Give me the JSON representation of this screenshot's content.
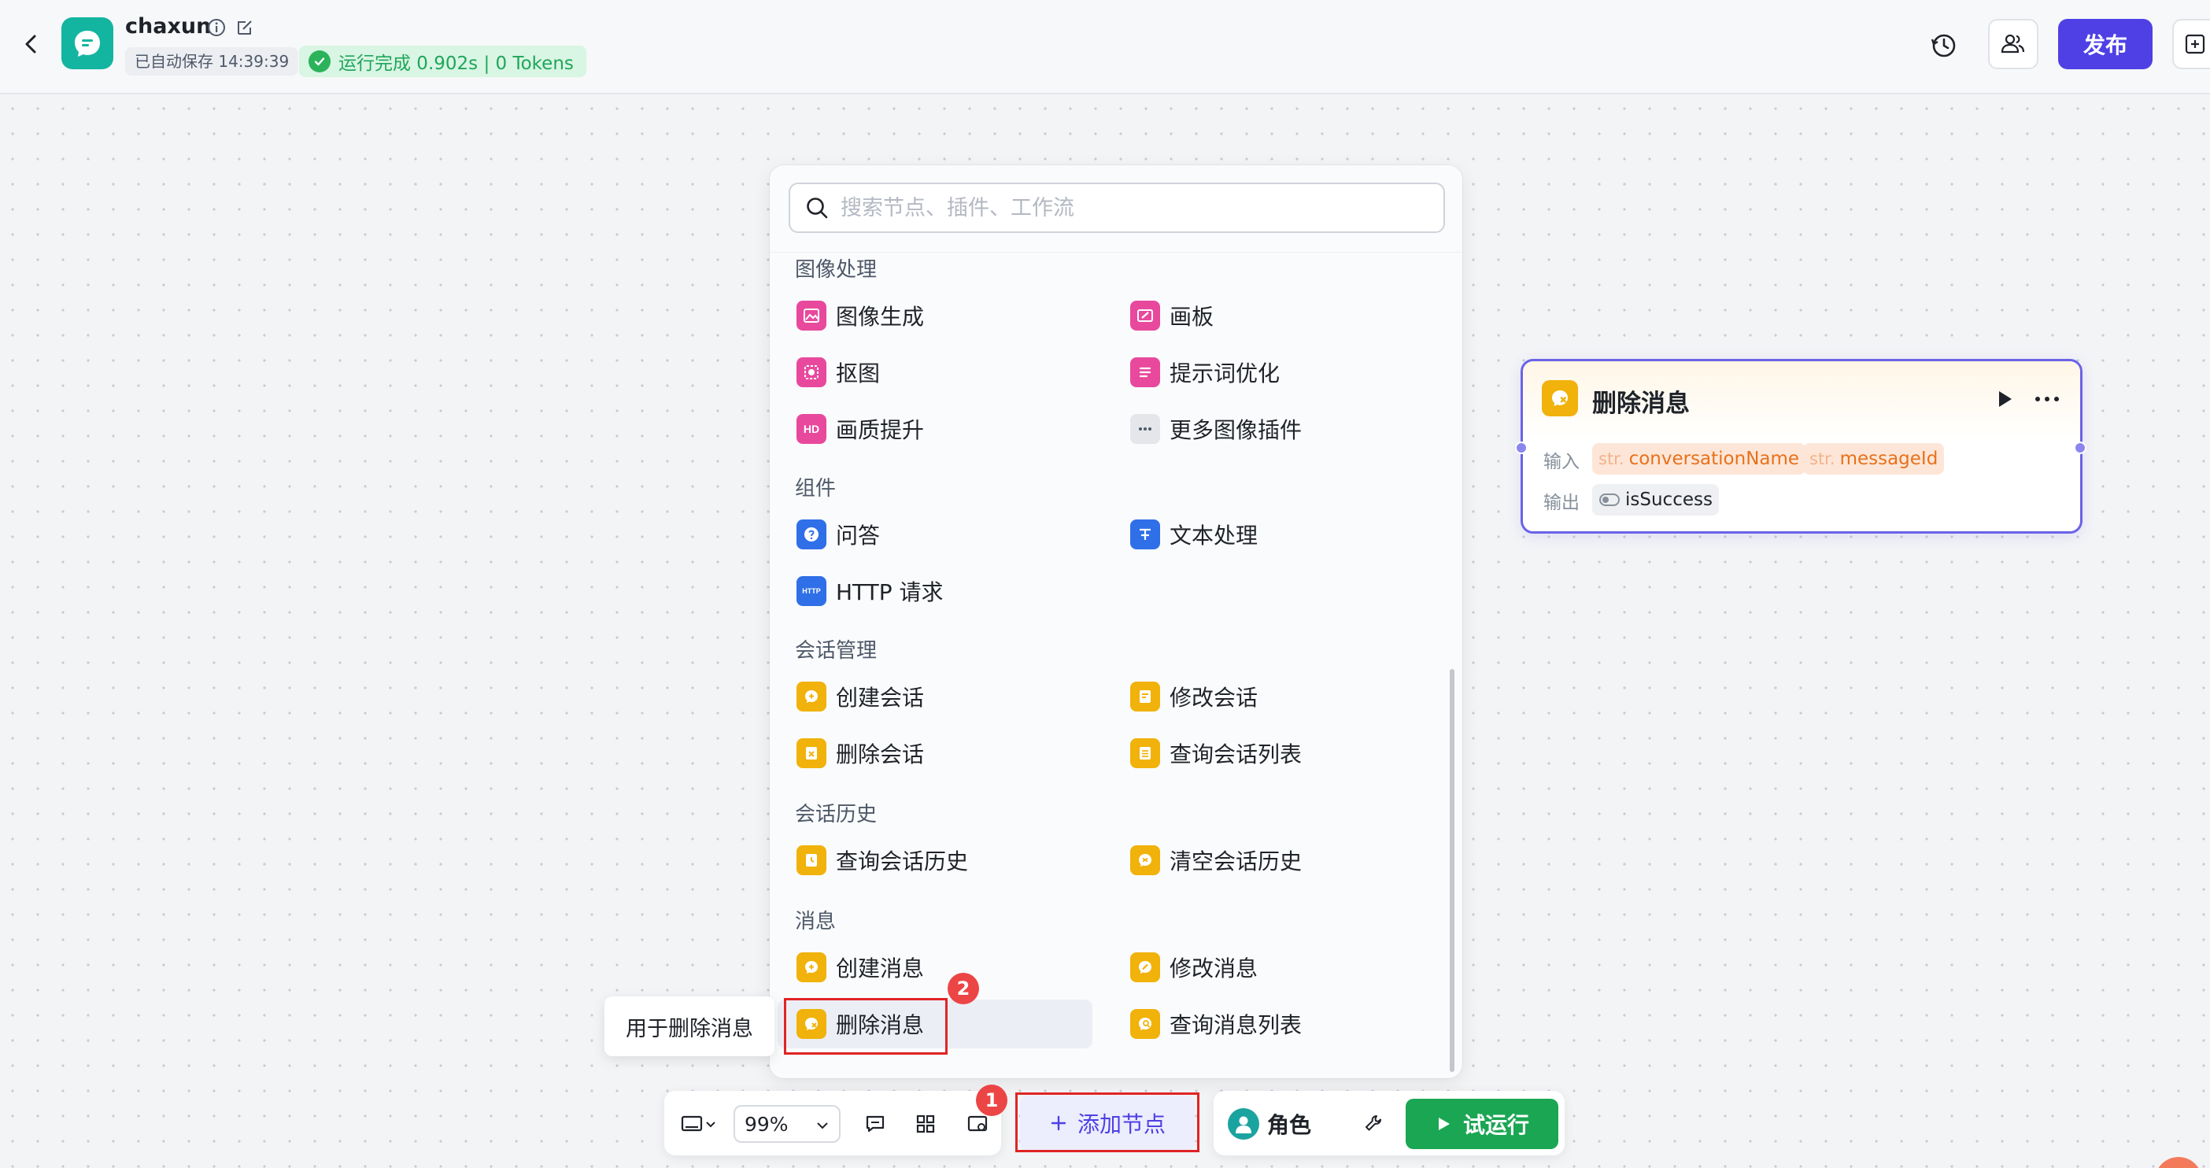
{
  "header": {
    "app_name": "chaxun",
    "autosave": "已自动保存 14:39:39",
    "run_status": "运行完成 0.902s | 0 Tokens",
    "publish_label": "发布",
    "icons": [
      "back-icon",
      "chat-app-icon",
      "info-icon",
      "edit-icon",
      "history-icon",
      "collaborators-icon"
    ]
  },
  "panel": {
    "search_placeholder": "搜索节点、插件、工作流",
    "categories": [
      {
        "title": "图像处理",
        "items": [
          {
            "label": "图像生成",
            "icon": "image-generate-icon"
          },
          {
            "label": "画板",
            "icon": "canvas-board-icon"
          },
          {
            "label": "抠图",
            "icon": "cutout-icon"
          },
          {
            "label": "提示词优化",
            "icon": "prompt-optimize-icon"
          },
          {
            "label": "画质提升",
            "icon": "hd-enhance-icon"
          },
          {
            "label": "更多图像插件",
            "icon": "more-icon"
          }
        ]
      },
      {
        "title": "组件",
        "items": [
          {
            "label": "问答",
            "icon": "question-icon"
          },
          {
            "label": "文本处理",
            "icon": "text-process-icon"
          },
          {
            "label": "HTTP 请求",
            "icon": "http-icon"
          }
        ]
      },
      {
        "title": "会话管理",
        "items": [
          {
            "label": "创建会话",
            "icon": "create-conversation-icon"
          },
          {
            "label": "修改会话",
            "icon": "edit-conversation-icon"
          },
          {
            "label": "删除会话",
            "icon": "delete-conversation-icon"
          },
          {
            "label": "查询会话列表",
            "icon": "list-conversation-icon"
          }
        ]
      },
      {
        "title": "会话历史",
        "items": [
          {
            "label": "查询会话历史",
            "icon": "query-history-icon"
          },
          {
            "label": "清空会话历史",
            "icon": "clear-history-icon"
          }
        ]
      },
      {
        "title": "消息",
        "items": [
          {
            "label": "创建消息",
            "icon": "create-message-icon"
          },
          {
            "label": "修改消息",
            "icon": "edit-message-icon"
          },
          {
            "label": "删除消息",
            "icon": "delete-message-icon"
          },
          {
            "label": "查询消息列表",
            "icon": "list-message-icon"
          }
        ]
      }
    ]
  },
  "tooltip": "用于删除消息",
  "annotations": {
    "badge_1": "1",
    "badge_2": "2"
  },
  "node": {
    "title": "删除消息",
    "input_label": "输入",
    "output_label": "输出",
    "inputs": [
      {
        "type": "str.",
        "name": "conversationName"
      },
      {
        "type": "str.",
        "name": "messageId"
      }
    ],
    "outputs": [
      {
        "name": "isSuccess",
        "icon": "boolean-toggle-icon"
      }
    ]
  },
  "toolbar": {
    "zoom": "99%",
    "add_node_label": "添加节点",
    "role_label": "角色",
    "test_run_label": "试运行"
  },
  "colors": {
    "accent": "#4e40e5",
    "success": "#1ba653",
    "node_yellow": "#f0b20b",
    "image_pink": "#e8499d",
    "component_blue": "#2f6fe8",
    "annotation_red": "#e02424"
  }
}
